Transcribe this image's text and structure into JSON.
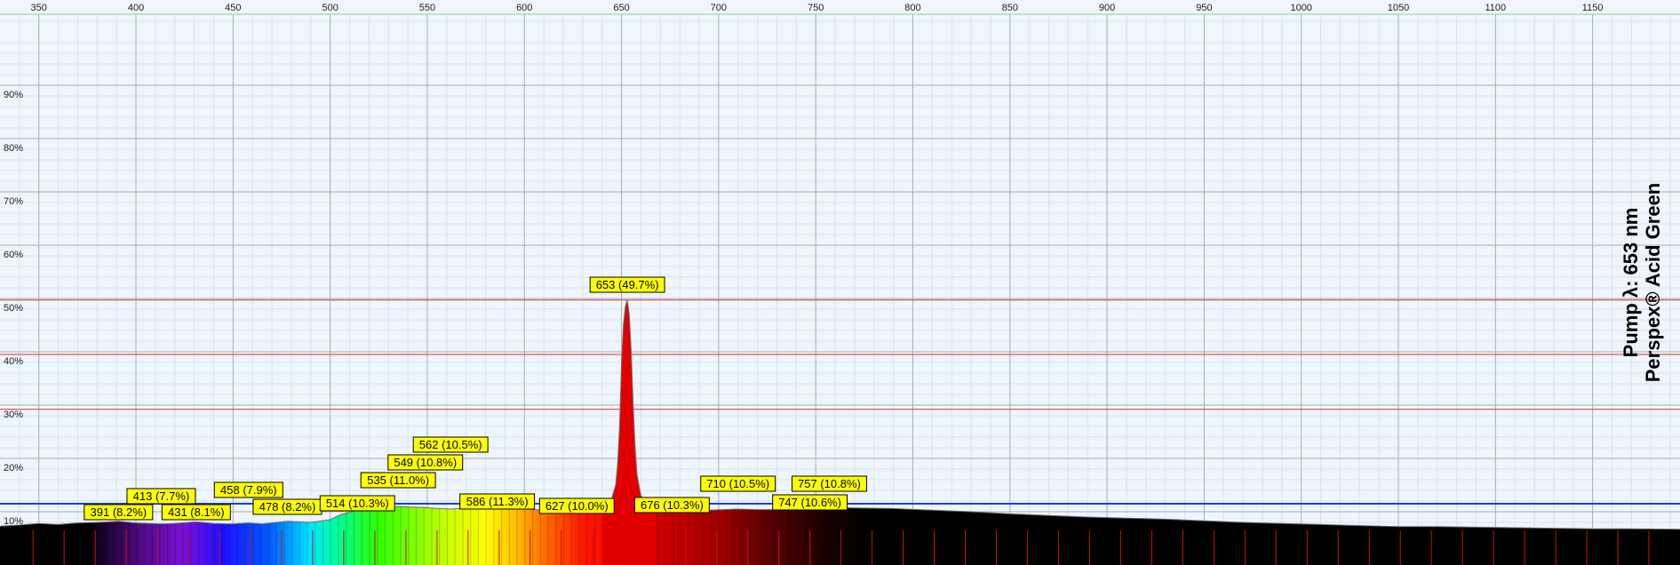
{
  "chart_data": {
    "type": "area",
    "title": "",
    "xlabel": "",
    "ylabel": "",
    "xlim": [
      330,
      1195
    ],
    "ylim": [
      0,
      100
    ],
    "x_ticks": [
      350,
      400,
      450,
      500,
      550,
      600,
      650,
      700,
      750,
      800,
      850,
      900,
      950,
      1000,
      1050,
      1100,
      1150
    ],
    "y_ticks": [
      10,
      20,
      30,
      40,
      50,
      60,
      70,
      80,
      90
    ],
    "y_tick_labels": [
      "10%",
      "20%",
      "30%",
      "40%",
      "50%",
      "60%",
      "70%",
      "80%",
      "90%"
    ],
    "grid": true,
    "reference_lines": [
      {
        "y": 49.7,
        "color": "#e0302a"
      },
      {
        "y": 39.5,
        "color": "#e0302a"
      },
      {
        "y": 29.2,
        "color": "#e0302a"
      },
      {
        "y": 11.5,
        "color": "#1a3fd0"
      }
    ],
    "series": [
      {
        "x": [
          330,
          340,
          350,
          360,
          370,
          380,
          391,
          400,
          413,
          420,
          431,
          440,
          450,
          458,
          465,
          478,
          490,
          500,
          505,
          514,
          520,
          530,
          535,
          540,
          549,
          555,
          562,
          570,
          580,
          586,
          595,
          605,
          615,
          627,
          635,
          640,
          643,
          645,
          647,
          648,
          649,
          650,
          651,
          652,
          653,
          654,
          655,
          656,
          657,
          658,
          660,
          663,
          668,
          676,
          685,
          695,
          710,
          720,
          730,
          747,
          757,
          770,
          790,
          810,
          830,
          850,
          870,
          890,
          910,
          930,
          950,
          970,
          990,
          1010,
          1030,
          1050,
          1070,
          1090,
          1110,
          1130,
          1150,
          1170,
          1195
        ],
        "y": [
          7.3,
          7.5,
          7.8,
          7.6,
          7.9,
          8.0,
          8.2,
          7.9,
          7.7,
          7.8,
          8.1,
          7.8,
          7.7,
          7.9,
          7.7,
          8.2,
          8.0,
          8.5,
          9.4,
          10.3,
          10.2,
          10.6,
          11.0,
          10.9,
          10.8,
          10.6,
          10.5,
          10.7,
          11.0,
          11.3,
          10.8,
          10.4,
          10.2,
          10.0,
          10.1,
          10.5,
          11.2,
          12.5,
          15.0,
          19.0,
          26.0,
          38.0,
          45.0,
          48.5,
          49.7,
          47.0,
          40.0,
          30.0,
          22.0,
          17.0,
          13.0,
          11.5,
          10.8,
          10.3,
          10.2,
          10.3,
          10.5,
          10.4,
          10.4,
          10.6,
          10.8,
          10.7,
          10.6,
          10.3,
          10.0,
          9.6,
          9.3,
          9.0,
          8.8,
          8.6,
          8.3,
          8.0,
          7.8,
          7.6,
          7.4,
          7.2,
          7.2,
          7.1,
          7.0,
          6.9,
          6.8,
          6.8,
          6.7
        ]
      }
    ],
    "annotations": [
      {
        "x": 391,
        "y": 8.2,
        "text": "391 (8.2%)"
      },
      {
        "x": 413,
        "y": 7.7,
        "text": "413 (7.7%)"
      },
      {
        "x": 431,
        "y": 8.1,
        "text": "431 (8.1%)"
      },
      {
        "x": 458,
        "y": 7.9,
        "text": "458 (7.9%)"
      },
      {
        "x": 478,
        "y": 8.2,
        "text": "478 (8.2%)"
      },
      {
        "x": 514,
        "y": 10.3,
        "text": "514 (10.3%)"
      },
      {
        "x": 535,
        "y": 11.0,
        "text": "535 (11.0%)"
      },
      {
        "x": 549,
        "y": 10.8,
        "text": "549 (10.8%)"
      },
      {
        "x": 562,
        "y": 10.5,
        "text": "562 (10.5%)"
      },
      {
        "x": 586,
        "y": 11.3,
        "text": "586 (11.3%)"
      },
      {
        "x": 627,
        "y": 10.0,
        "text": "627 (10.0%)"
      },
      {
        "x": 653,
        "y": 49.7,
        "text": "653 (49.7%)"
      },
      {
        "x": 676,
        "y": 10.3,
        "text": "676 (10.3%)"
      },
      {
        "x": 710,
        "y": 10.5,
        "text": "710 (10.5%)"
      },
      {
        "x": 747,
        "y": 10.6,
        "text": "747 (10.6%)"
      },
      {
        "x": 757,
        "y": 10.8,
        "text": "757 (10.8%)"
      }
    ],
    "side_text": [
      "Pump λ: 653 nm",
      "Perspex® Acid Green"
    ],
    "colors": {
      "background": "#eef5fd",
      "grid_major": "#a9adb3",
      "grid_minor": "#d6e2ee",
      "label_fill": "#ffff00",
      "dark_band": "#000000",
      "curve": "#707070",
      "peak_fill": "#e00000"
    }
  }
}
